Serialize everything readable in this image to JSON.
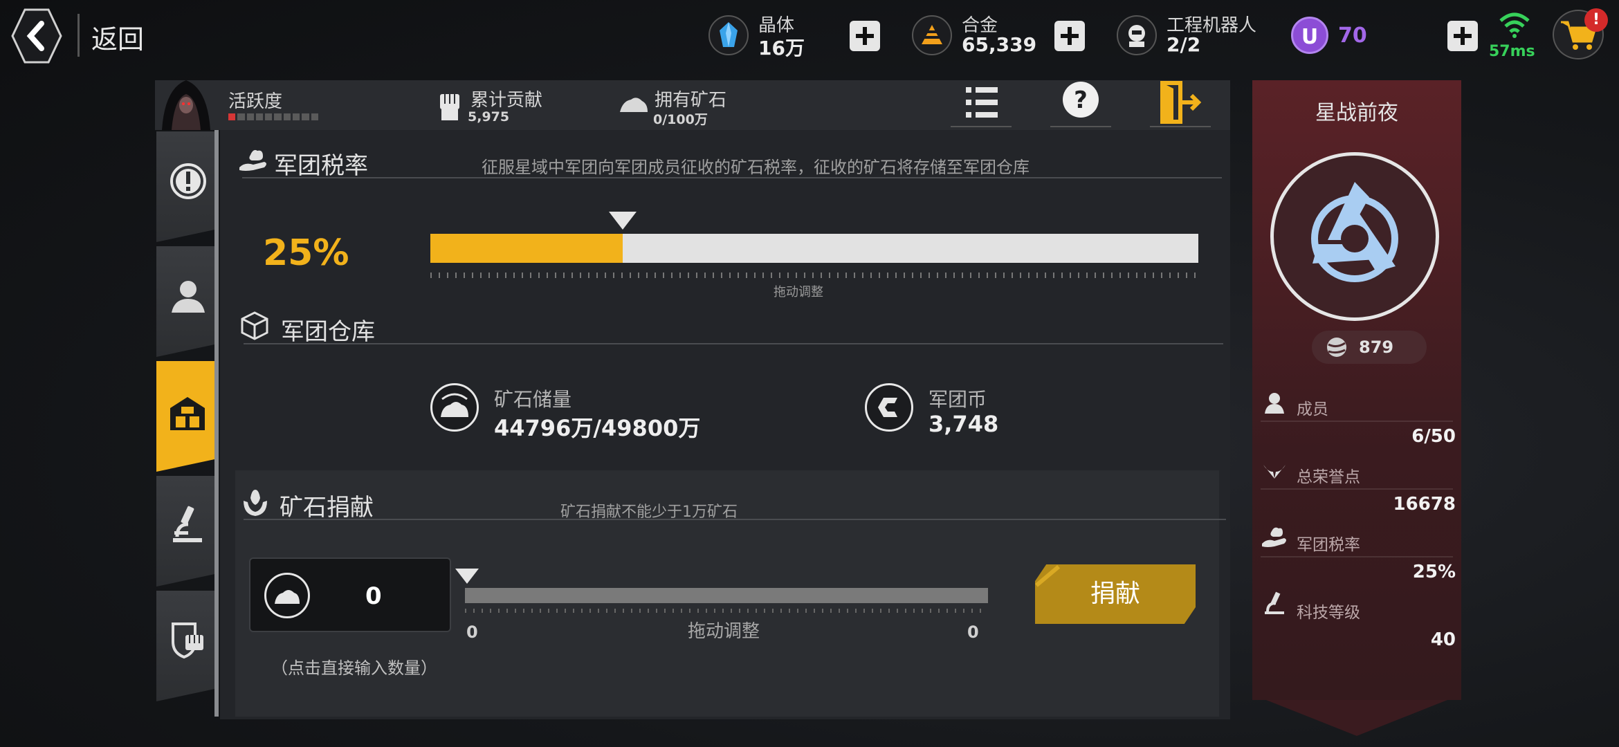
{
  "topbar": {
    "back_label": "返回",
    "resources": [
      {
        "name": "晶体",
        "value": "16万",
        "icon": "crystal-icon"
      },
      {
        "name": "合金",
        "value": "65,339",
        "icon": "alloy-icon"
      },
      {
        "name": "工程机器人",
        "value": "2/2",
        "icon": "robot-icon"
      }
    ],
    "premium": {
      "symbol": "U",
      "value": "70"
    },
    "ping": "57ms",
    "cart_badge": "!"
  },
  "header": {
    "activity_label": "活跃度",
    "activity_level": 0.1,
    "contribution_label": "累计贡献",
    "contribution_value": "5,975",
    "ore_owned_label": "拥有矿石",
    "ore_owned_value": "0/100万"
  },
  "tax": {
    "title": "军团税率",
    "description": "征服星域中军团向军团成员征收的矿石税率，征收的矿石将存储至军团仓库",
    "percent_label": "25%",
    "value": 0.25,
    "caption": "拖动调整"
  },
  "warehouse": {
    "title": "军团仓库",
    "ore_label": "矿石储量",
    "ore_value": "44796万/49800万",
    "coin_label": "军团币",
    "coin_value": "3,748"
  },
  "donate": {
    "title": "矿石捐献",
    "note": "矿石捐献不能少于1万矿石",
    "quantity": "0",
    "hint": "（点击直接输入数量）",
    "slider_min": "0",
    "slider_max": "0",
    "caption": "拖动调整",
    "button_label": "捐献"
  },
  "guild": {
    "name": "星战前夜",
    "rank": "879",
    "stats": [
      {
        "label": "成员",
        "value": "6/50"
      },
      {
        "label": "总荣誉点",
        "value": "16678"
      },
      {
        "label": "军团税率",
        "value": "25%"
      },
      {
        "label": "科技等级",
        "value": "40"
      }
    ]
  },
  "colors": {
    "accent": "#f2b21b",
    "banner": "#5a2227",
    "ping": "#37d15a",
    "premium": "#8c4dd6",
    "alert": "#d42a2a"
  }
}
